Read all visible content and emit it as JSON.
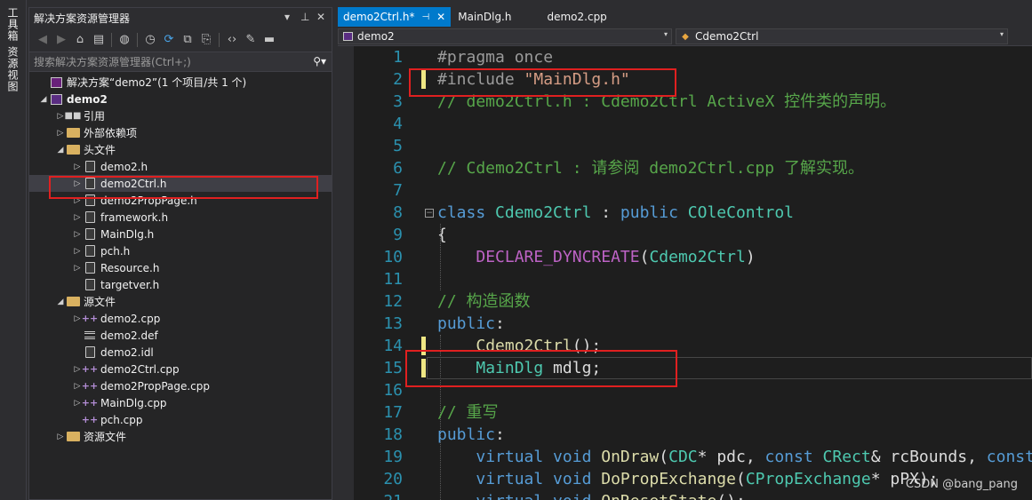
{
  "left_strip": {
    "tab1": "工具箱",
    "tab2": "资源视图"
  },
  "explorer": {
    "title": "解决方案资源管理器",
    "controls": [
      "▾",
      "⊥",
      "✕"
    ],
    "search_placeholder": "搜索解决方案资源管理器(Ctrl+;)",
    "tree": [
      {
        "label": "解决方案“demo2”(1 个项目/共 1 个)",
        "icon": "solution-icon",
        "arrow": "",
        "indent": 0
      },
      {
        "label": "demo2",
        "icon": "project-icon",
        "arrow": "◢",
        "indent": 0,
        "bold": true
      },
      {
        "label": "引用",
        "icon": "references-icon",
        "arrow": "▷",
        "indent": 1
      },
      {
        "label": "外部依赖项",
        "icon": "folder-icon",
        "arrow": "▷",
        "indent": 1
      },
      {
        "label": "头文件",
        "icon": "folder-icon",
        "arrow": "◢",
        "indent": 1
      },
      {
        "label": "demo2.h",
        "icon": "header-file-icon",
        "arrow": "▷",
        "indent": 2
      },
      {
        "label": "demo2Ctrl.h",
        "icon": "header-file-icon",
        "arrow": "▷",
        "indent": 2,
        "selected": true
      },
      {
        "label": "demo2PropPage.h",
        "icon": "header-file-icon",
        "arrow": "▷",
        "indent": 2
      },
      {
        "label": "framework.h",
        "icon": "header-file-icon",
        "arrow": "▷",
        "indent": 2
      },
      {
        "label": "MainDlg.h",
        "icon": "header-file-icon",
        "arrow": "▷",
        "indent": 2
      },
      {
        "label": "pch.h",
        "icon": "header-file-icon",
        "arrow": "▷",
        "indent": 2
      },
      {
        "label": "Resource.h",
        "icon": "header-file-icon",
        "arrow": "▷",
        "indent": 2
      },
      {
        "label": "targetver.h",
        "icon": "header-file-icon",
        "arrow": "",
        "indent": 2
      },
      {
        "label": "源文件",
        "icon": "folder-icon",
        "arrow": "◢",
        "indent": 1
      },
      {
        "label": "demo2.cpp",
        "icon": "cpp-file-icon",
        "arrow": "▷",
        "indent": 2
      },
      {
        "label": "demo2.def",
        "icon": "def-file-icon",
        "arrow": "",
        "indent": 2
      },
      {
        "label": "demo2.idl",
        "icon": "idl-file-icon",
        "arrow": "",
        "indent": 2
      },
      {
        "label": "demo2Ctrl.cpp",
        "icon": "cpp-file-icon",
        "arrow": "▷",
        "indent": 2
      },
      {
        "label": "demo2PropPage.cpp",
        "icon": "cpp-file-icon",
        "arrow": "▷",
        "indent": 2
      },
      {
        "label": "MainDlg.cpp",
        "icon": "cpp-file-icon",
        "arrow": "▷",
        "indent": 2
      },
      {
        "label": "pch.cpp",
        "icon": "cpp-file-icon",
        "arrow": "",
        "indent": 2
      },
      {
        "label": "资源文件",
        "icon": "folder-icon",
        "arrow": "▷",
        "indent": 1
      }
    ]
  },
  "editor": {
    "tabs": [
      {
        "label": "demo2Ctrl.h*",
        "active": true
      },
      {
        "label": "MainDlg.h",
        "active": false
      },
      {
        "label": "demo2.cpp",
        "active": false
      }
    ],
    "nav_project": "demo2",
    "nav_class": "Cdemo2Ctrl",
    "lines": [
      {
        "n": "1",
        "parts": [
          [
            "pp",
            "#pragma once"
          ]
        ]
      },
      {
        "n": "2",
        "parts": [
          [
            "pp",
            "#include "
          ],
          [
            "s",
            "\"MainDlg.h\""
          ]
        ],
        "changed": true
      },
      {
        "n": "3",
        "parts": [
          [
            "c",
            "// demo2Ctrl.h : Cdemo2Ctrl ActiveX 控件类的声明。"
          ]
        ]
      },
      {
        "n": "4",
        "parts": []
      },
      {
        "n": "5",
        "parts": []
      },
      {
        "n": "6",
        "parts": [
          [
            "c",
            "// Cdemo2Ctrl : 请参阅 demo2Ctrl.cpp 了解实现。"
          ]
        ]
      },
      {
        "n": "7",
        "parts": []
      },
      {
        "n": "8",
        "parts": [
          [
            "k",
            "class "
          ],
          [
            "t",
            "Cdemo2Ctrl"
          ],
          [
            "p",
            " : "
          ],
          [
            "k",
            "public "
          ],
          [
            "t",
            "COleControl"
          ]
        ],
        "fold": true
      },
      {
        "n": "9",
        "parts": [
          [
            "p",
            "{"
          ]
        ]
      },
      {
        "n": "10",
        "parts": [
          [
            "p",
            "    "
          ],
          [
            "m",
            "DECLARE_DYNCREATE"
          ],
          [
            "p",
            "("
          ],
          [
            "t",
            "Cdemo2Ctrl"
          ],
          [
            "p",
            ")"
          ]
        ]
      },
      {
        "n": "11",
        "parts": []
      },
      {
        "n": "12",
        "parts": [
          [
            "c",
            "// 构造函数"
          ]
        ]
      },
      {
        "n": "13",
        "parts": [
          [
            "k",
            "public"
          ],
          [
            "p",
            ":"
          ]
        ]
      },
      {
        "n": "14",
        "parts": [
          [
            "p",
            "    "
          ],
          [
            "f",
            "Cdemo2Ctrl"
          ],
          [
            "p",
            "();"
          ]
        ],
        "changed": true
      },
      {
        "n": "15",
        "parts": [
          [
            "p",
            "    "
          ],
          [
            "t",
            "MainDlg"
          ],
          [
            "p",
            " mdlg;"
          ]
        ],
        "changed": true,
        "current": true
      },
      {
        "n": "16",
        "parts": []
      },
      {
        "n": "17",
        "parts": [
          [
            "c",
            "// 重写"
          ]
        ]
      },
      {
        "n": "18",
        "parts": [
          [
            "k",
            "public"
          ],
          [
            "p",
            ":"
          ]
        ]
      },
      {
        "n": "19",
        "parts": [
          [
            "p",
            "    "
          ],
          [
            "k",
            "virtual void "
          ],
          [
            "f",
            "OnDraw"
          ],
          [
            "p",
            "("
          ],
          [
            "t",
            "CDC"
          ],
          [
            "p",
            "* pdc, "
          ],
          [
            "k",
            "const "
          ],
          [
            "t",
            "CRect"
          ],
          [
            "p",
            "& rcBounds, "
          ],
          [
            "k",
            "const"
          ]
        ]
      },
      {
        "n": "20",
        "parts": [
          [
            "p",
            "    "
          ],
          [
            "k",
            "virtual void "
          ],
          [
            "f",
            "DoPropExchange"
          ],
          [
            "p",
            "("
          ],
          [
            "t",
            "CPropExchange"
          ],
          [
            "p",
            "* pPX);"
          ]
        ]
      },
      {
        "n": "21",
        "parts": [
          [
            "p",
            "    "
          ],
          [
            "k",
            "virtual void "
          ],
          [
            "f",
            "OnResetState"
          ],
          [
            "p",
            "();"
          ]
        ]
      }
    ],
    "watermark": "CSDN @bang_pang"
  },
  "colors": {
    "accent": "#007acc",
    "highlight_box": "#e02020",
    "change_marker": "#efe784"
  }
}
